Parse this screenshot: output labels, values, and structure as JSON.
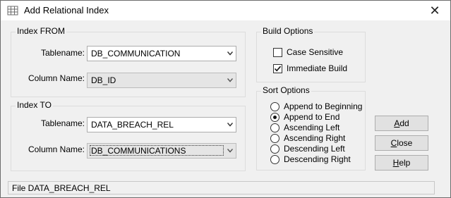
{
  "window": {
    "title": "Add Relational Index",
    "close": "✕"
  },
  "index_from": {
    "title": "Index FROM",
    "tablename_label": "Tablename:",
    "tablename_value": "DB_COMMUNICATION",
    "column_label": "Column Name:",
    "column_value": "DB_ID"
  },
  "index_to": {
    "title": "Index TO",
    "tablename_label": "Tablename:",
    "tablename_value": "DATA_BREACH_REL",
    "column_label": "Column Name:",
    "column_value": "DB_COMMUNICATIONS"
  },
  "build_options": {
    "title": "Build Options",
    "items": [
      {
        "label": "Case Sensitive",
        "checked": false
      },
      {
        "label": "Immediate Build",
        "checked": true
      }
    ]
  },
  "sort_options": {
    "title": "Sort Options",
    "items": [
      {
        "label": "Append to Beginning",
        "selected": false
      },
      {
        "label": "Append to End",
        "selected": true
      },
      {
        "label": "Ascending Left",
        "selected": false
      },
      {
        "label": "Ascending Right",
        "selected": false
      },
      {
        "label": "Descending Left",
        "selected": false
      },
      {
        "label": "Descending Right",
        "selected": false
      }
    ]
  },
  "buttons": {
    "add": {
      "accel": "A",
      "rest": "dd"
    },
    "close": {
      "accel": "C",
      "rest": "lose"
    },
    "help": {
      "accel": "H",
      "rest": "elp"
    }
  },
  "status_bar": {
    "text": "File DATA_BREACH_REL"
  }
}
